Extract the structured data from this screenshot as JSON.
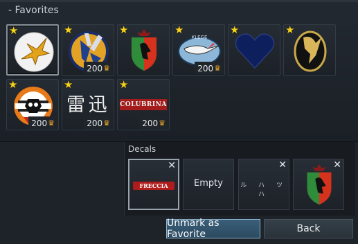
{
  "favorites": {
    "header": "- Favorites",
    "items": [
      {
        "name": "golden-eagle-emblem",
        "price": ""
      },
      {
        "name": "blue-wasp-emblem",
        "price": "200"
      },
      {
        "name": "rooster-shield-emblem",
        "price": ""
      },
      {
        "name": "stork-emblem",
        "price": "200"
      },
      {
        "name": "heart-emblem",
        "price": ""
      },
      {
        "name": "pegasus-emblem",
        "price": ""
      },
      {
        "name": "target-skull-emblem",
        "price": "200"
      },
      {
        "name": "kanji-emblem",
        "kanji": "雷 迅",
        "price": "200"
      },
      {
        "name": "colubrina-emblem",
        "text": "COLUBRINA",
        "price": "200"
      }
    ],
    "stork_text": "KLEGE"
  },
  "decals": {
    "label": "Decals",
    "slots": [
      {
        "name": "freccia-decal",
        "text": "FRECCIA"
      },
      {
        "name": "empty-slot",
        "text": "Empty"
      },
      {
        "name": "katakana-decal",
        "text": "ル ハ ツ ハ"
      },
      {
        "name": "rooster-shield-decal",
        "text": ""
      }
    ]
  },
  "buttons": {
    "unmark": "Unmark as Favorite",
    "back": "Back"
  },
  "colors": {
    "star": "#f4d11b",
    "accent_button": "#3a5e78",
    "price_icon": "#e8a62b"
  }
}
